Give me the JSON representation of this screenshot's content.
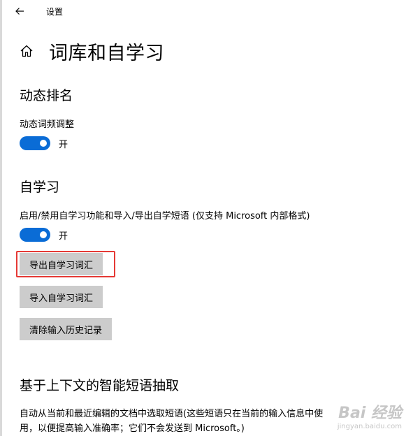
{
  "window": {
    "title": "设置"
  },
  "page": {
    "title": "词库和自学习"
  },
  "sections": {
    "dynamic_ranking": {
      "title": "动态排名",
      "setting_label": "动态词频调整",
      "toggle_state": "开"
    },
    "self_learning": {
      "title": "自学习",
      "setting_label": "启用/禁用自学习功能和导入/导出自学短语 (仅支持 Microsoft 内部格式)",
      "toggle_state": "开",
      "export_button": "导出自学习词汇",
      "import_button": "导入自学习词汇",
      "clear_history_button": "清除输入历史记录"
    },
    "context_phrase": {
      "title": "基于上下文的智能短语抽取",
      "description": "自动从当前和最近编辑的文档中选取短语(这些短语只在当前的输入信息中使用，以便提高输入准确率；它们不会发送到 Microsoft。)"
    }
  },
  "watermark": {
    "main": "Bai 经验",
    "sub": "jingyan.baidu.com"
  },
  "icons": {
    "back": "back-arrow-icon",
    "home": "home-icon"
  },
  "colors": {
    "toggle_on": "#0a6cd6",
    "button_bg": "#cccccc",
    "highlight": "#e53935"
  }
}
